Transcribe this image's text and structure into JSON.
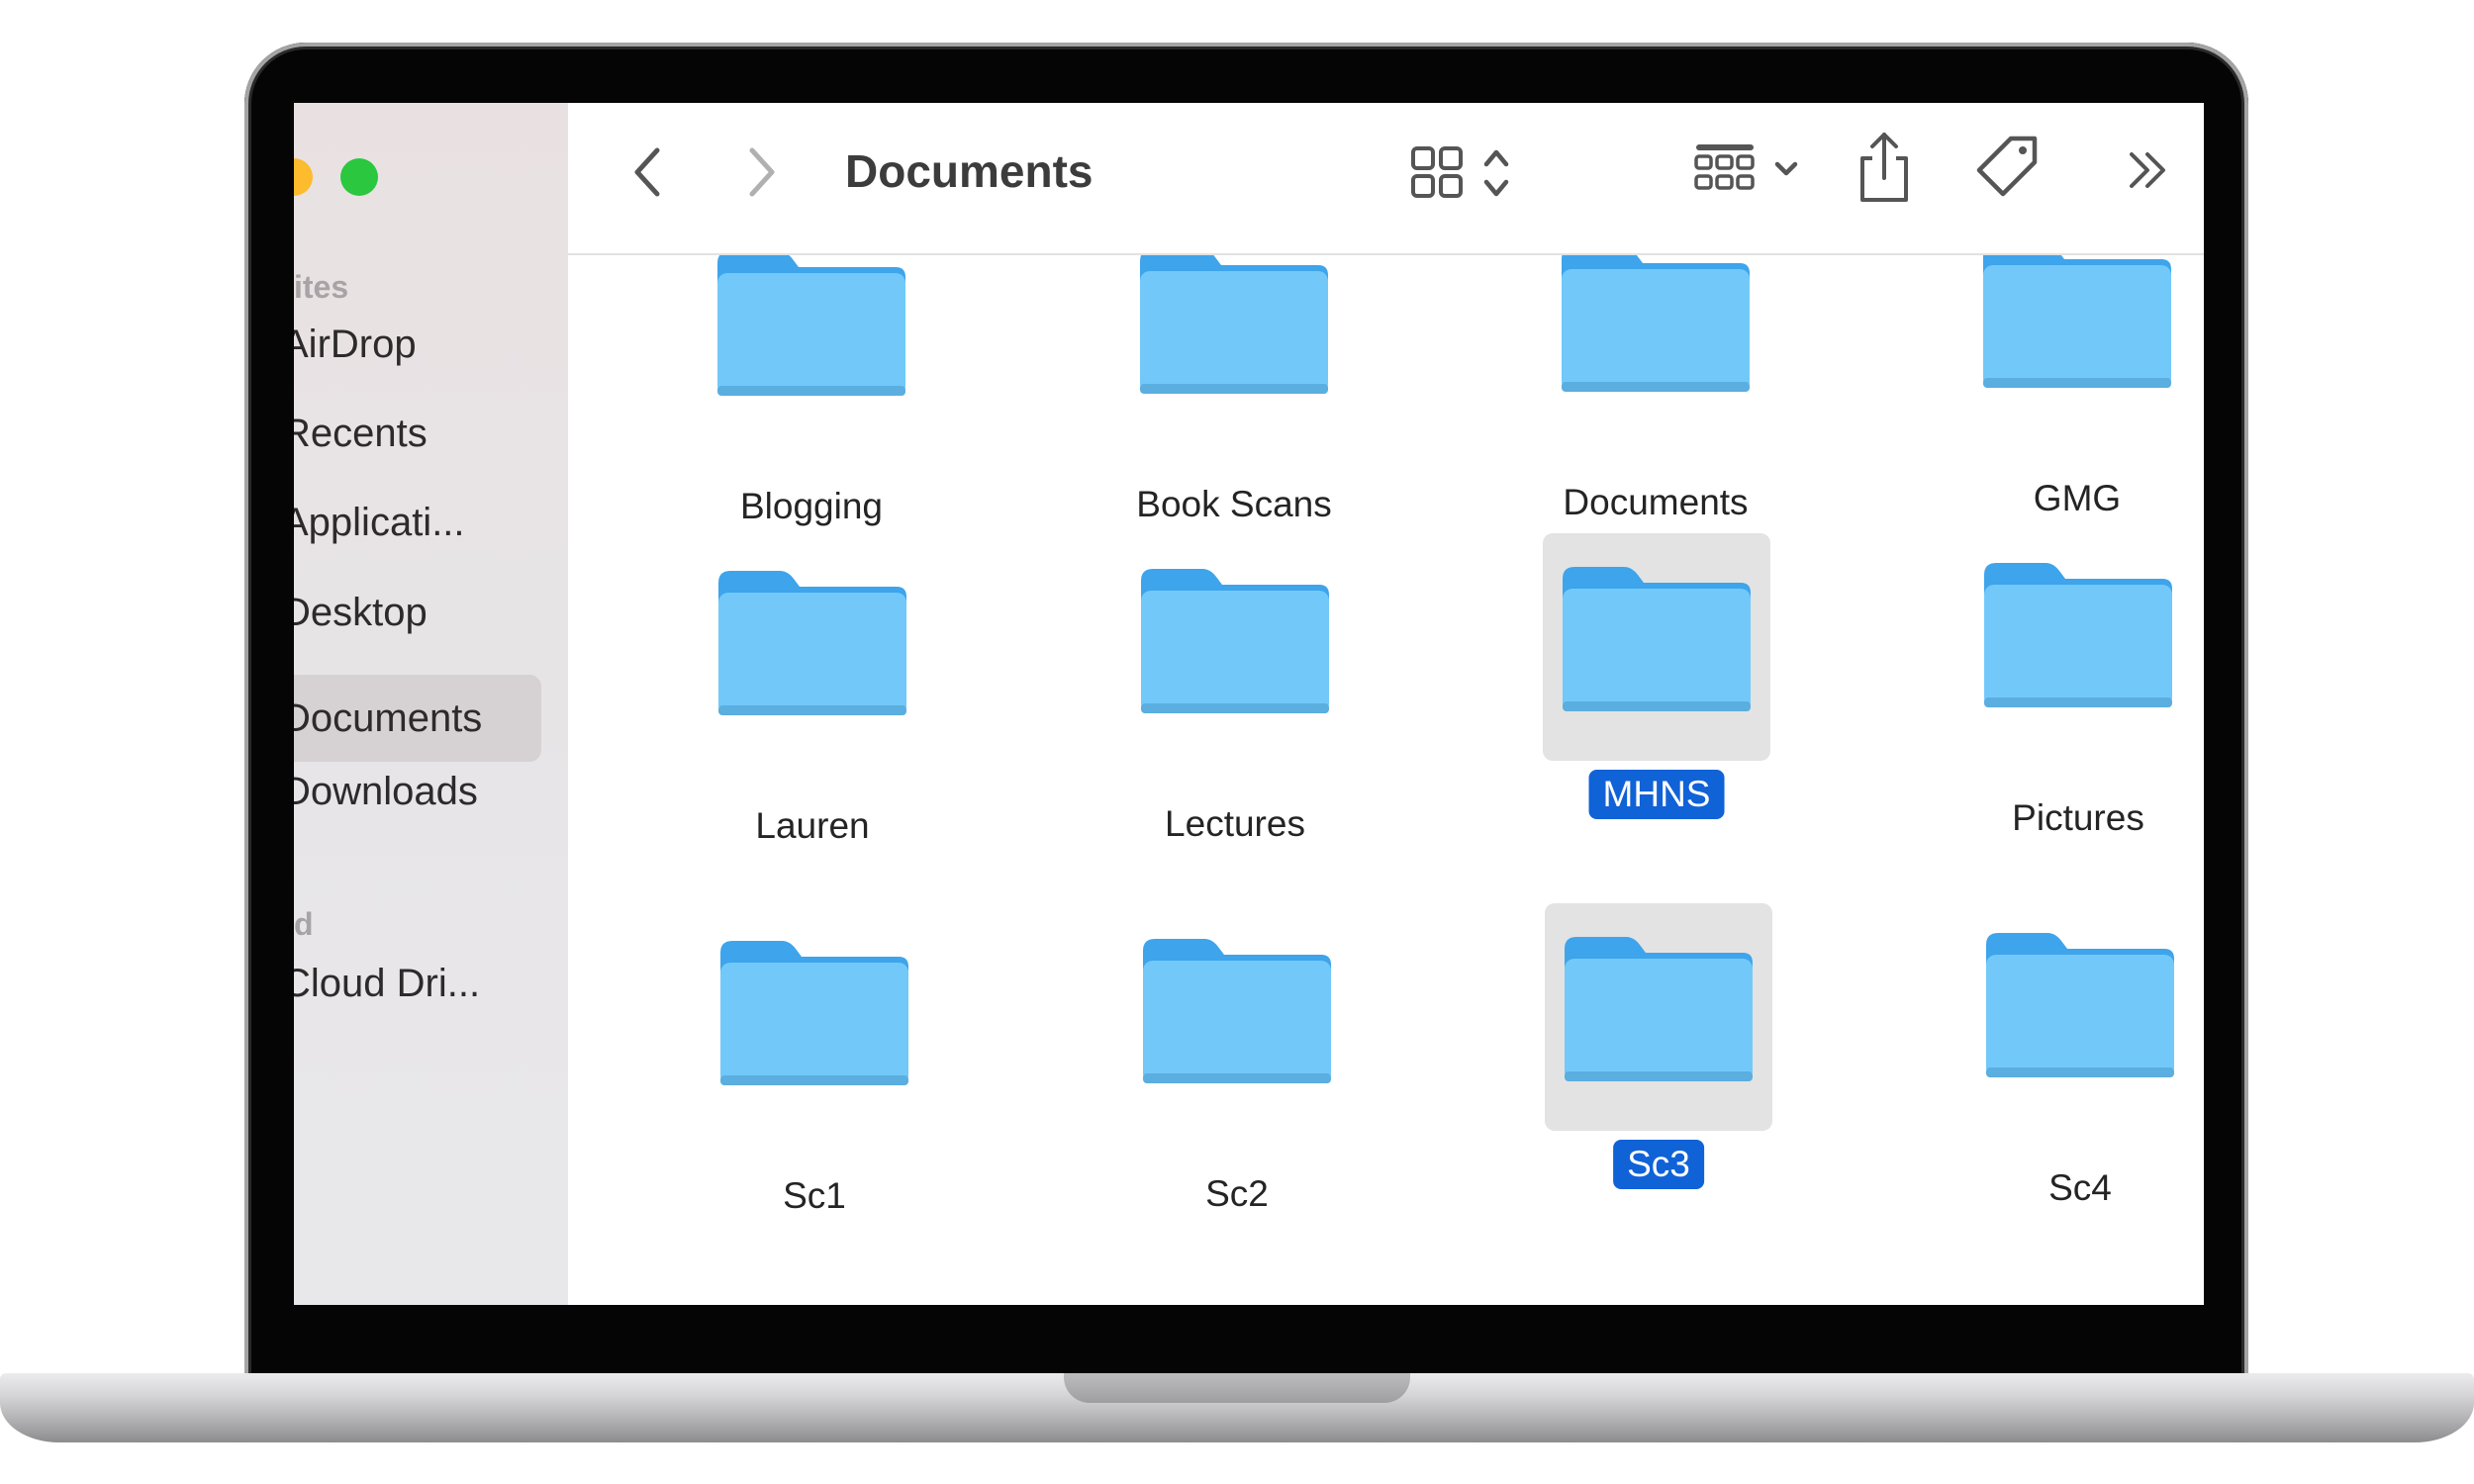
{
  "window": {
    "title": "Documents"
  },
  "sidebar": {
    "favorites_heading": "ites",
    "icloud_heading": "d",
    "items": [
      {
        "label": "AirDrop"
      },
      {
        "label": "Recents"
      },
      {
        "label": "Applicati..."
      },
      {
        "label": "Desktop"
      },
      {
        "label": "Documents",
        "active": true
      },
      {
        "label": "Downloads"
      },
      {
        "label": "Cloud Dri..."
      }
    ]
  },
  "toolbar": {
    "back_icon": "chevron-left-icon",
    "forward_icon": "chevron-right-icon",
    "view_icon": "icon-grid-view-icon",
    "group_icon": "group-by-icon",
    "share_icon": "share-icon",
    "tag_icon": "tag-icon",
    "more_icon": "double-chevron-icon"
  },
  "folders": [
    {
      "name": "Blogging",
      "selected": false
    },
    {
      "name": "Book Scans",
      "selected": false
    },
    {
      "name": "Documents",
      "selected": false
    },
    {
      "name": "GMG",
      "selected": false
    },
    {
      "name": "Lauren",
      "selected": false
    },
    {
      "name": "Lectures",
      "selected": false
    },
    {
      "name": "MHNS",
      "selected": true
    },
    {
      "name": "Pictures",
      "selected": false
    },
    {
      "name": "Sc1",
      "selected": false
    },
    {
      "name": "Sc2",
      "selected": false
    },
    {
      "name": "Sc3",
      "selected": true
    },
    {
      "name": "Sc4",
      "selected": false
    }
  ],
  "colors": {
    "folder": "#72c9f9",
    "folder_tab": "#3ea4eb",
    "selection": "#1062d7"
  }
}
